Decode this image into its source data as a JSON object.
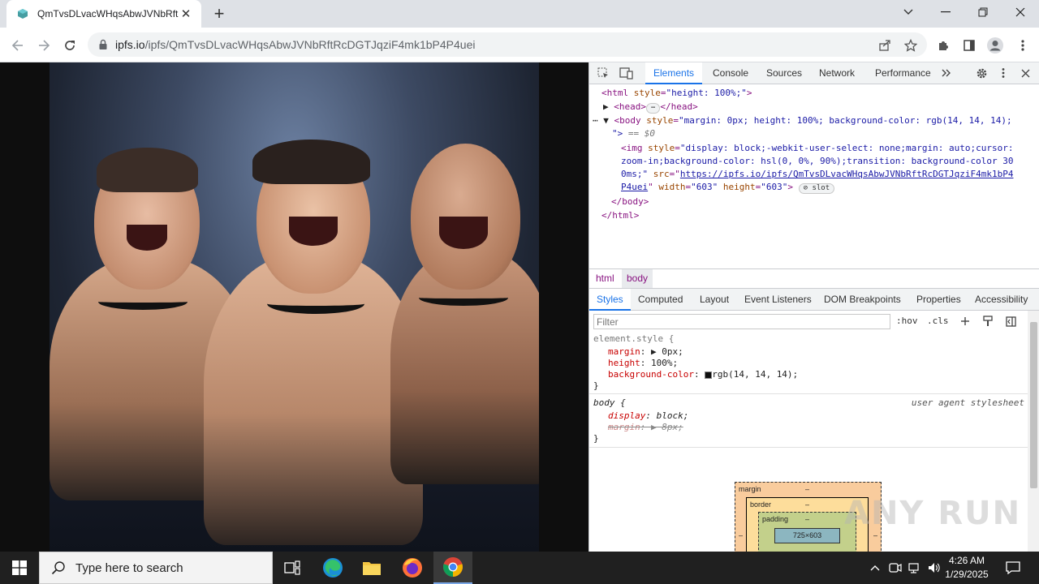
{
  "browser": {
    "tab_title": "QmTvsDLvacWHqsAbwJVNbRftR",
    "url_host": "ipfs.io",
    "url_path": "/ipfs/QmTvsDLvacWHqsAbwJVNbRftRcDGTJqziF4mk1bP4P4uei"
  },
  "devtools": {
    "tabs": [
      "Elements",
      "Console",
      "Sources",
      "Network",
      "Performance"
    ],
    "active_tab": "Elements",
    "dom": {
      "html_open": "<html",
      "html_style_attr": "style",
      "html_style_val": "\"height: 100%;\"",
      "head": "<head>",
      "head_close": "</head>",
      "body_open": "<body",
      "body_style_attr": "style",
      "body_style_val": "\"margin: 0px; height: 100%; background-color: rgb(14, 14, 14);",
      "body_style_end": "\">",
      "eq_dollar": "== $0",
      "img_open": "<img",
      "img_style_attr": "style",
      "img_style_val1": "\"display: block;-webkit-user-select: none;margin: auto;cursor:",
      "img_style_val2": "zoom-in;background-color: hsl(0, 0%, 90%);transition: background-color 30",
      "img_style_val3": "0ms;\"",
      "img_src_attr": "src",
      "img_src_val1": "https://ipfs.io/ipfs/QmTvsDLvacWHqsAbwJVNbRftRcDGTJqziF4mk1bP4",
      "img_src_val2": "P4uei",
      "img_width_attr": "width",
      "img_width_val": "\"603\"",
      "img_height_attr": "height",
      "img_height_val": "\"603\"",
      "slot": "slot",
      "body_close": "</body>",
      "html_close": "</html>"
    },
    "breadcrumbs": [
      "html",
      "body"
    ],
    "styles_tabs": [
      "Styles",
      "Computed",
      "Layout",
      "Event Listeners",
      "DOM Breakpoints",
      "Properties",
      "Accessibility"
    ],
    "filter_placeholder": "Filter",
    "hov": ":hov",
    "cls": ".cls",
    "rules": {
      "element_style": "element.style {",
      "margin_prop": "margin",
      "margin_val": "0px;",
      "height_prop": "height",
      "height_val": "100%;",
      "bg_prop": "background-color",
      "bg_val": "rgb(14, 14, 14);",
      "close": "}",
      "body_sel": "body {",
      "ua": "user agent stylesheet",
      "display_prop": "display",
      "display_val": "block;",
      "ua_margin_prop": "margin",
      "ua_margin_val": "8px;",
      "close2": "}"
    },
    "box_model": {
      "margin_label": "margin",
      "border_label": "border",
      "padding_label": "padding",
      "dash": "–",
      "content": "725×603"
    }
  },
  "watermark": "ANY RUN",
  "taskbar": {
    "search_placeholder": "Type here to search",
    "time": "4:26 AM",
    "date": "1/29/2025"
  },
  "colors": {
    "accent": "#1a73e8",
    "page_bg": "#0e0e0e",
    "swatch": "#0e0e0e"
  }
}
